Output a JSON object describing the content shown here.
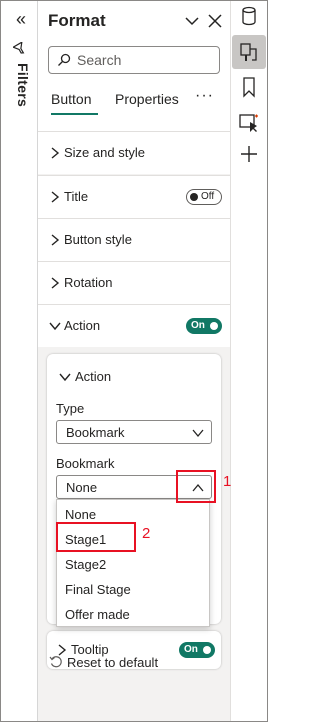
{
  "filters_rail": {
    "label": "Filters"
  },
  "format_pane": {
    "title": "Format",
    "search": {
      "placeholder": "Search"
    },
    "tabs": [
      {
        "label": "Button",
        "active": true
      },
      {
        "label": "Properties",
        "active": false
      }
    ],
    "more_label": "···",
    "sections": [
      {
        "label": "Size and style"
      },
      {
        "label": "Title",
        "toggle": "Off"
      },
      {
        "label": "Button style"
      },
      {
        "label": "Rotation"
      },
      {
        "label": "Action",
        "toggle": "On",
        "expanded": true
      }
    ],
    "action_card": {
      "title": "Action",
      "type_label": "Type",
      "type_value": "Bookmark",
      "bookmark_label": "Bookmark",
      "bookmark_value": "None",
      "bookmark_options": [
        "None",
        "Stage1",
        "Stage2",
        "Final Stage",
        "Offer made"
      ]
    },
    "tooltip_section": {
      "label": "Tooltip",
      "toggle": "On"
    },
    "reset_label": "Reset to default"
  },
  "annotations": {
    "callout_1": "1",
    "callout_2": "2"
  },
  "colors": {
    "accent": "#117865",
    "annotation": "#e81123",
    "pane_bg": "#f3f2f1"
  }
}
